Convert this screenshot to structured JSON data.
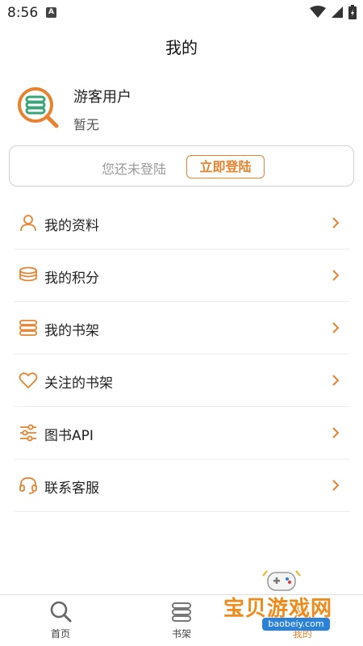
{
  "status_bar": {
    "time": "8:56",
    "notification_glyph": "A"
  },
  "header": {
    "title": "我的"
  },
  "profile": {
    "name": "游客用户",
    "subtitle": "暂无"
  },
  "login": {
    "hint": "您还未登陆",
    "button_label": "立即登陆"
  },
  "menu": {
    "items": [
      {
        "label": "我的资料",
        "icon": "user-icon"
      },
      {
        "label": "我的积分",
        "icon": "coins-icon"
      },
      {
        "label": "我的书架",
        "icon": "bookshelf-icon"
      },
      {
        "label": "关注的书架",
        "icon": "heart-icon"
      },
      {
        "label": "图书API",
        "icon": "sliders-icon"
      },
      {
        "label": "联系客服",
        "icon": "headset-icon"
      }
    ]
  },
  "tabs": [
    {
      "label": "首页",
      "icon": "search-icon",
      "active": false
    },
    {
      "label": "书架",
      "icon": "bookshelf-icon",
      "active": false
    },
    {
      "label": "我的",
      "icon": "profile-icon",
      "active": true
    }
  ],
  "watermark": {
    "text": "宝贝游戏网",
    "url": "baobeiy.com"
  },
  "colors": {
    "accent": "#e8822e",
    "logo_green": "#3aa57a",
    "text": "#222222",
    "divider": "#ececec"
  }
}
